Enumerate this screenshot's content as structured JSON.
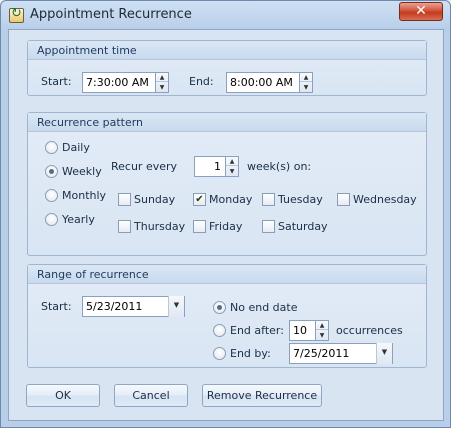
{
  "window": {
    "title": "Appointment Recurrence",
    "close_label": "✕"
  },
  "appointment_time": {
    "group_title": "Appointment time",
    "start_label": "Start:",
    "start_value": "7:30:00 AM",
    "end_label": "End:",
    "end_value": "8:00:00 AM"
  },
  "pattern": {
    "group_title": "Recurrence pattern",
    "frequencies": [
      "Daily",
      "Weekly",
      "Monthly",
      "Yearly"
    ],
    "selected_frequency": "Weekly",
    "recur_every_label": "Recur every",
    "recur_every_value": "1",
    "weeks_on_label": "week(s) on:",
    "days": [
      {
        "name": "Sunday",
        "checked": false
      },
      {
        "name": "Monday",
        "checked": true
      },
      {
        "name": "Tuesday",
        "checked": false
      },
      {
        "name": "Wednesday",
        "checked": false
      },
      {
        "name": "Thursday",
        "checked": false
      },
      {
        "name": "Friday",
        "checked": false
      },
      {
        "name": "Saturday",
        "checked": false
      }
    ]
  },
  "range": {
    "group_title": "Range of recurrence",
    "start_label": "Start:",
    "start_value": "5/23/2011",
    "no_end_label": "No end date",
    "end_after_label": "End after:",
    "end_after_value": "10",
    "occurrences_label": "occurrences",
    "end_by_label": "End by:",
    "end_by_value": "7/25/2011",
    "selected": "No end date"
  },
  "buttons": {
    "ok": "OK",
    "cancel": "Cancel",
    "remove": "Remove Recurrence"
  },
  "icons": {
    "spin_up": "▲",
    "spin_down": "▼",
    "dropdown": "▼",
    "check": "✔"
  }
}
